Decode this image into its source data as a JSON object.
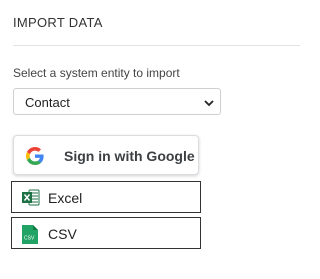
{
  "panel": {
    "title": "IMPORT DATA"
  },
  "entity_select": {
    "label": "Select a system entity to import",
    "selected": "Contact"
  },
  "google_button": {
    "label": "Sign in with Google"
  },
  "file_buttons": [
    {
      "label": "Excel",
      "icon": "excel-icon",
      "color": "#1e7145"
    },
    {
      "label": "CSV",
      "icon": "csv-icon",
      "icon_text": "CSV",
      "color": "#21a366"
    }
  ]
}
